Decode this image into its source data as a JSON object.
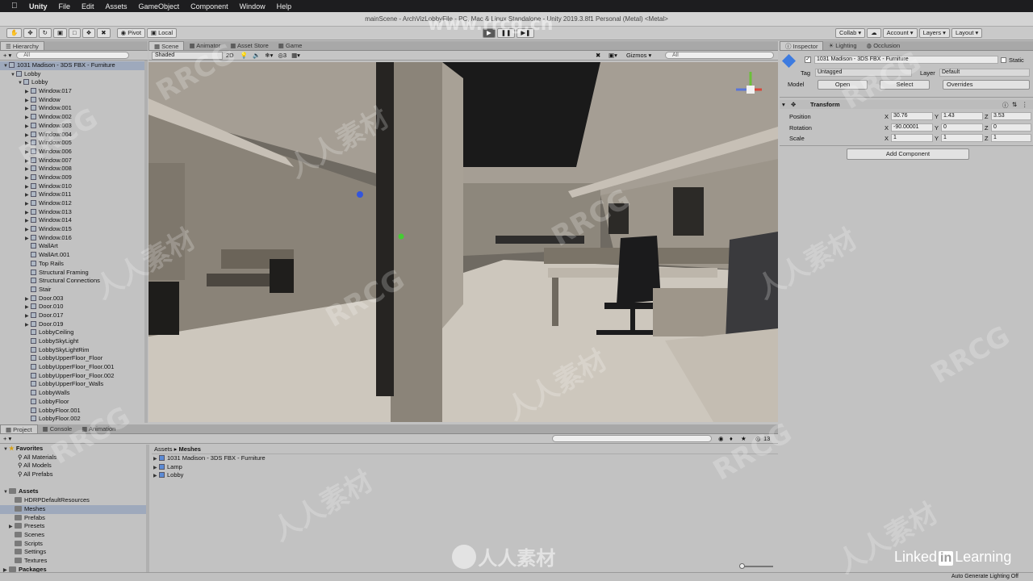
{
  "menubar": {
    "app": "Unity",
    "items": [
      "File",
      "Edit",
      "Assets",
      "GameObject",
      "Component",
      "Window",
      "Help"
    ]
  },
  "titlebar": {
    "title": "mainScene - ArchVizLobbyFile - PC, Mac & Linux Standalone - Unity 2019.3.8f1 Personal (Metal) <Metal>"
  },
  "toolbar": {
    "pivot": "Pivot",
    "local": "Local",
    "collab": "Collab ▾",
    "account": "Account ▾",
    "layers": "Layers ▾",
    "layout": "Layout ▾"
  },
  "hierarchy": {
    "tab": "Hierarchy",
    "create": "+ ▾",
    "search_placeholder": "All",
    "rows": [
      {
        "label": "1031 Madison - 3DS FBX - Furniture",
        "level": 0,
        "arrow": "▼",
        "selected": true
      },
      {
        "label": "Lobby",
        "level": 1,
        "arrow": "▼"
      },
      {
        "label": "Lobby",
        "level": 2,
        "arrow": "▼"
      },
      {
        "label": "Window.017",
        "level": 3,
        "arrow": "▶"
      },
      {
        "label": "Window",
        "level": 3,
        "arrow": "▶"
      },
      {
        "label": "Window.001",
        "level": 3,
        "arrow": "▶"
      },
      {
        "label": "Window.002",
        "level": 3,
        "arrow": "▶"
      },
      {
        "label": "Window.003",
        "level": 3,
        "arrow": "▶"
      },
      {
        "label": "Window.004",
        "level": 3,
        "arrow": "▶"
      },
      {
        "label": "Window.005",
        "level": 3,
        "arrow": "▶"
      },
      {
        "label": "Window.006",
        "level": 3,
        "arrow": "▶"
      },
      {
        "label": "Window.007",
        "level": 3,
        "arrow": "▶"
      },
      {
        "label": "Window.008",
        "level": 3,
        "arrow": "▶"
      },
      {
        "label": "Window.009",
        "level": 3,
        "arrow": "▶"
      },
      {
        "label": "Window.010",
        "level": 3,
        "arrow": "▶"
      },
      {
        "label": "Window.011",
        "level": 3,
        "arrow": "▶"
      },
      {
        "label": "Window.012",
        "level": 3,
        "arrow": "▶"
      },
      {
        "label": "Window.013",
        "level": 3,
        "arrow": "▶"
      },
      {
        "label": "Window.014",
        "level": 3,
        "arrow": "▶"
      },
      {
        "label": "Window.015",
        "level": 3,
        "arrow": "▶"
      },
      {
        "label": "Window.016",
        "level": 3,
        "arrow": "▶"
      },
      {
        "label": "WallArt",
        "level": 3,
        "arrow": ""
      },
      {
        "label": "WallArt.001",
        "level": 3,
        "arrow": ""
      },
      {
        "label": "Top Rails",
        "level": 3,
        "arrow": ""
      },
      {
        "label": "Structural Framing",
        "level": 3,
        "arrow": ""
      },
      {
        "label": "Structural Connections",
        "level": 3,
        "arrow": ""
      },
      {
        "label": "Stair",
        "level": 3,
        "arrow": ""
      },
      {
        "label": "Door.003",
        "level": 3,
        "arrow": "▶"
      },
      {
        "label": "Door.010",
        "level": 3,
        "arrow": "▶"
      },
      {
        "label": "Door.017",
        "level": 3,
        "arrow": "▶"
      },
      {
        "label": "Door.019",
        "level": 3,
        "arrow": "▶"
      },
      {
        "label": "LobbyCeiling",
        "level": 3,
        "arrow": ""
      },
      {
        "label": "LobbySkyLight",
        "level": 3,
        "arrow": ""
      },
      {
        "label": "LobbySkyLightRim",
        "level": 3,
        "arrow": ""
      },
      {
        "label": "LobbyUpperFloor_Floor",
        "level": 3,
        "arrow": ""
      },
      {
        "label": "LobbyUpperFloor_Floor.001",
        "level": 3,
        "arrow": ""
      },
      {
        "label": "LobbyUpperFloor_Floor.002",
        "level": 3,
        "arrow": ""
      },
      {
        "label": "LobbyUpperFloor_Walls",
        "level": 3,
        "arrow": ""
      },
      {
        "label": "LobbyWalls",
        "level": 3,
        "arrow": ""
      },
      {
        "label": "LobbyFloor",
        "level": 3,
        "arrow": ""
      },
      {
        "label": "LobbyFloor.001",
        "level": 3,
        "arrow": ""
      },
      {
        "label": "LobbyFloor.002",
        "level": 3,
        "arrow": ""
      }
    ]
  },
  "scene": {
    "tabs": [
      "Scene",
      "Animator",
      "Asset Store",
      "Game"
    ],
    "active_tab": "Scene",
    "shading": "Shaded",
    "mode_2d": "2D",
    "gizmos": "Gizmos",
    "search_placeholder": "All",
    "layer_count": "3"
  },
  "inspector": {
    "tabs": [
      "Inspector",
      "Lighting",
      "Occlusion"
    ],
    "object_name": "1031 Madison - 3DS FBX - Furniture",
    "static_label": "Static",
    "tag_label": "Tag",
    "tag_value": "Untagged",
    "layer_label": "Layer",
    "layer_value": "Default",
    "model_label": "Model",
    "open": "Open",
    "select": "Select",
    "overrides": "Overrides",
    "component_title": "Transform",
    "position_label": "Position",
    "rotation_label": "Rotation",
    "scale_label": "Scale",
    "pos": {
      "x": "30.76",
      "y": "1.43",
      "z": "3.53"
    },
    "rot": {
      "x": "-90.00001",
      "y": "0",
      "z": "0"
    },
    "scl": {
      "x": "1",
      "y": "1",
      "z": "1"
    },
    "add_component": "Add Component"
  },
  "project": {
    "tabs": [
      "Project",
      "Console",
      "Animation"
    ],
    "create": "+ ▾",
    "favorites": "Favorites",
    "favorite_items": [
      "All Materials",
      "All Models",
      "All Prefabs"
    ],
    "assets": "Assets",
    "asset_folders": [
      "HDRPDefaultResources",
      "Meshes",
      "Prefabs",
      "Presets",
      "Scenes",
      "Scripts",
      "Settings",
      "Textures"
    ],
    "packages": "Packages",
    "breadcrumb_root": "Assets",
    "breadcrumb_sep": "▸",
    "breadcrumb_current": "Meshes",
    "files": [
      "1031 Madison - 3DS FBX - Furniture",
      "Lamp",
      "Lobby"
    ],
    "hidden_count": "13"
  },
  "status": {
    "text": "Auto Generate Lighting Off"
  },
  "branding": {
    "linkedin": "Linked",
    "in": "in",
    "learning": "Learning",
    "center_logo": "人人素材"
  },
  "watermarks": {
    "rrcg": "RRCG",
    "cn": "人人素材",
    "url": "www.rrcg.cn"
  },
  "colors": {
    "accent": "#3d7be0",
    "selection": "#9ea9bc"
  }
}
